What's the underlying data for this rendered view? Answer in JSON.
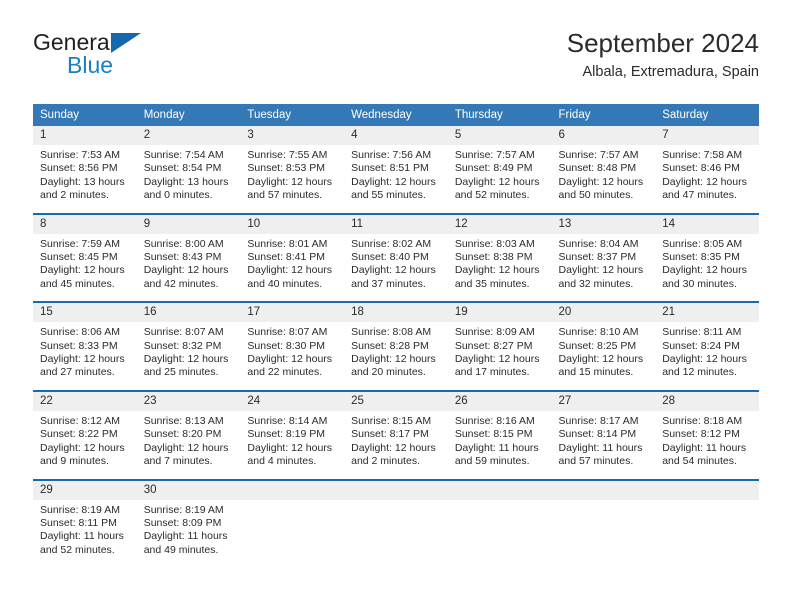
{
  "brand": {
    "name_top": "General",
    "name_bottom": "Blue",
    "triangle_color": "#1567ae",
    "blue_text_color": "#1c7fc4"
  },
  "header": {
    "title": "September 2024",
    "subtitle": "Albala, Extremadura, Spain"
  },
  "colors": {
    "header_row_bg": "#3479b5",
    "week_separator": "#1a6ab0",
    "daynum_bg": "#efefef",
    "text": "#2b2b2b"
  },
  "weekdays": [
    "Sunday",
    "Monday",
    "Tuesday",
    "Wednesday",
    "Thursday",
    "Friday",
    "Saturday"
  ],
  "weeks": [
    {
      "days": [
        {
          "num": "1",
          "sunrise": "Sunrise: 7:53 AM",
          "sunset": "Sunset: 8:56 PM",
          "daylight1": "Daylight: 13 hours",
          "daylight2": "and 2 minutes."
        },
        {
          "num": "2",
          "sunrise": "Sunrise: 7:54 AM",
          "sunset": "Sunset: 8:54 PM",
          "daylight1": "Daylight: 13 hours",
          "daylight2": "and 0 minutes."
        },
        {
          "num": "3",
          "sunrise": "Sunrise: 7:55 AM",
          "sunset": "Sunset: 8:53 PM",
          "daylight1": "Daylight: 12 hours",
          "daylight2": "and 57 minutes."
        },
        {
          "num": "4",
          "sunrise": "Sunrise: 7:56 AM",
          "sunset": "Sunset: 8:51 PM",
          "daylight1": "Daylight: 12 hours",
          "daylight2": "and 55 minutes."
        },
        {
          "num": "5",
          "sunrise": "Sunrise: 7:57 AM",
          "sunset": "Sunset: 8:49 PM",
          "daylight1": "Daylight: 12 hours",
          "daylight2": "and 52 minutes."
        },
        {
          "num": "6",
          "sunrise": "Sunrise: 7:57 AM",
          "sunset": "Sunset: 8:48 PM",
          "daylight1": "Daylight: 12 hours",
          "daylight2": "and 50 minutes."
        },
        {
          "num": "7",
          "sunrise": "Sunrise: 7:58 AM",
          "sunset": "Sunset: 8:46 PM",
          "daylight1": "Daylight: 12 hours",
          "daylight2": "and 47 minutes."
        }
      ]
    },
    {
      "days": [
        {
          "num": "8",
          "sunrise": "Sunrise: 7:59 AM",
          "sunset": "Sunset: 8:45 PM",
          "daylight1": "Daylight: 12 hours",
          "daylight2": "and 45 minutes."
        },
        {
          "num": "9",
          "sunrise": "Sunrise: 8:00 AM",
          "sunset": "Sunset: 8:43 PM",
          "daylight1": "Daylight: 12 hours",
          "daylight2": "and 42 minutes."
        },
        {
          "num": "10",
          "sunrise": "Sunrise: 8:01 AM",
          "sunset": "Sunset: 8:41 PM",
          "daylight1": "Daylight: 12 hours",
          "daylight2": "and 40 minutes."
        },
        {
          "num": "11",
          "sunrise": "Sunrise: 8:02 AM",
          "sunset": "Sunset: 8:40 PM",
          "daylight1": "Daylight: 12 hours",
          "daylight2": "and 37 minutes."
        },
        {
          "num": "12",
          "sunrise": "Sunrise: 8:03 AM",
          "sunset": "Sunset: 8:38 PM",
          "daylight1": "Daylight: 12 hours",
          "daylight2": "and 35 minutes."
        },
        {
          "num": "13",
          "sunrise": "Sunrise: 8:04 AM",
          "sunset": "Sunset: 8:37 PM",
          "daylight1": "Daylight: 12 hours",
          "daylight2": "and 32 minutes."
        },
        {
          "num": "14",
          "sunrise": "Sunrise: 8:05 AM",
          "sunset": "Sunset: 8:35 PM",
          "daylight1": "Daylight: 12 hours",
          "daylight2": "and 30 minutes."
        }
      ]
    },
    {
      "days": [
        {
          "num": "15",
          "sunrise": "Sunrise: 8:06 AM",
          "sunset": "Sunset: 8:33 PM",
          "daylight1": "Daylight: 12 hours",
          "daylight2": "and 27 minutes."
        },
        {
          "num": "16",
          "sunrise": "Sunrise: 8:07 AM",
          "sunset": "Sunset: 8:32 PM",
          "daylight1": "Daylight: 12 hours",
          "daylight2": "and 25 minutes."
        },
        {
          "num": "17",
          "sunrise": "Sunrise: 8:07 AM",
          "sunset": "Sunset: 8:30 PM",
          "daylight1": "Daylight: 12 hours",
          "daylight2": "and 22 minutes."
        },
        {
          "num": "18",
          "sunrise": "Sunrise: 8:08 AM",
          "sunset": "Sunset: 8:28 PM",
          "daylight1": "Daylight: 12 hours",
          "daylight2": "and 20 minutes."
        },
        {
          "num": "19",
          "sunrise": "Sunrise: 8:09 AM",
          "sunset": "Sunset: 8:27 PM",
          "daylight1": "Daylight: 12 hours",
          "daylight2": "and 17 minutes."
        },
        {
          "num": "20",
          "sunrise": "Sunrise: 8:10 AM",
          "sunset": "Sunset: 8:25 PM",
          "daylight1": "Daylight: 12 hours",
          "daylight2": "and 15 minutes."
        },
        {
          "num": "21",
          "sunrise": "Sunrise: 8:11 AM",
          "sunset": "Sunset: 8:24 PM",
          "daylight1": "Daylight: 12 hours",
          "daylight2": "and 12 minutes."
        }
      ]
    },
    {
      "days": [
        {
          "num": "22",
          "sunrise": "Sunrise: 8:12 AM",
          "sunset": "Sunset: 8:22 PM",
          "daylight1": "Daylight: 12 hours",
          "daylight2": "and 9 minutes."
        },
        {
          "num": "23",
          "sunrise": "Sunrise: 8:13 AM",
          "sunset": "Sunset: 8:20 PM",
          "daylight1": "Daylight: 12 hours",
          "daylight2": "and 7 minutes."
        },
        {
          "num": "24",
          "sunrise": "Sunrise: 8:14 AM",
          "sunset": "Sunset: 8:19 PM",
          "daylight1": "Daylight: 12 hours",
          "daylight2": "and 4 minutes."
        },
        {
          "num": "25",
          "sunrise": "Sunrise: 8:15 AM",
          "sunset": "Sunset: 8:17 PM",
          "daylight1": "Daylight: 12 hours",
          "daylight2": "and 2 minutes."
        },
        {
          "num": "26",
          "sunrise": "Sunrise: 8:16 AM",
          "sunset": "Sunset: 8:15 PM",
          "daylight1": "Daylight: 11 hours",
          "daylight2": "and 59 minutes."
        },
        {
          "num": "27",
          "sunrise": "Sunrise: 8:17 AM",
          "sunset": "Sunset: 8:14 PM",
          "daylight1": "Daylight: 11 hours",
          "daylight2": "and 57 minutes."
        },
        {
          "num": "28",
          "sunrise": "Sunrise: 8:18 AM",
          "sunset": "Sunset: 8:12 PM",
          "daylight1": "Daylight: 11 hours",
          "daylight2": "and 54 minutes."
        }
      ]
    },
    {
      "days": [
        {
          "num": "29",
          "sunrise": "Sunrise: 8:19 AM",
          "sunset": "Sunset: 8:11 PM",
          "daylight1": "Daylight: 11 hours",
          "daylight2": "and 52 minutes."
        },
        {
          "num": "30",
          "sunrise": "Sunrise: 8:19 AM",
          "sunset": "Sunset: 8:09 PM",
          "daylight1": "Daylight: 11 hours",
          "daylight2": "and 49 minutes."
        },
        {
          "num": "",
          "sunrise": "",
          "sunset": "",
          "daylight1": "",
          "daylight2": ""
        },
        {
          "num": "",
          "sunrise": "",
          "sunset": "",
          "daylight1": "",
          "daylight2": ""
        },
        {
          "num": "",
          "sunrise": "",
          "sunset": "",
          "daylight1": "",
          "daylight2": ""
        },
        {
          "num": "",
          "sunrise": "",
          "sunset": "",
          "daylight1": "",
          "daylight2": ""
        },
        {
          "num": "",
          "sunrise": "",
          "sunset": "",
          "daylight1": "",
          "daylight2": ""
        }
      ]
    }
  ]
}
